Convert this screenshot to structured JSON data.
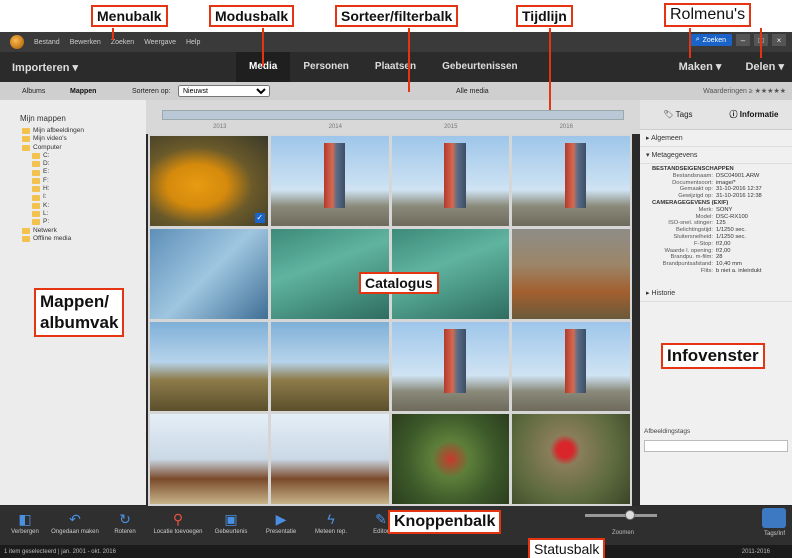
{
  "menubar": {
    "items": [
      "Bestand",
      "Bewerken",
      "Zoeken",
      "Weergave",
      "Help"
    ],
    "search_label": "Zoeken"
  },
  "modebar": {
    "import_label": "Importeren",
    "tabs": [
      "Media",
      "Personen",
      "Plaatsen",
      "Gebeurtenissen"
    ],
    "create_label": "Maken",
    "share_label": "Delen"
  },
  "filterbar": {
    "albums_label": "Albums",
    "folders_label": "Mappen",
    "sort_label": "Sorteren op:",
    "sort_value": "Nieuwst",
    "all_media_label": "Alle media",
    "ratings_label": "Waarderingen"
  },
  "left_panel": {
    "header": "Mijn mappen",
    "folders": [
      {
        "label": "Mijn afbeeldingen",
        "sub": false
      },
      {
        "label": "Mijn video's",
        "sub": false
      },
      {
        "label": "Computer",
        "sub": false
      },
      {
        "label": "C:",
        "sub": true
      },
      {
        "label": "D:",
        "sub": true
      },
      {
        "label": "E:",
        "sub": true
      },
      {
        "label": "F:",
        "sub": true
      },
      {
        "label": "H:",
        "sub": true
      },
      {
        "label": "I:",
        "sub": true
      },
      {
        "label": "K:",
        "sub": true
      },
      {
        "label": "L:",
        "sub": true
      },
      {
        "label": "P:",
        "sub": true
      },
      {
        "label": "Netwerk",
        "sub": false
      },
      {
        "label": "Offline media",
        "sub": false
      }
    ]
  },
  "timeline": {
    "years": [
      "2013",
      "2014",
      "2015",
      "2016"
    ]
  },
  "right_panel": {
    "tab_tags": "Tags",
    "tab_info": "Informatie",
    "section_general": "Algemeen",
    "section_metadata": "Metagegevens",
    "file_props_header": "BESTANDSEIGENSCHAPPEN",
    "file_props": [
      {
        "k": "Bestandsnaam:",
        "v": "DSC04901.ARW"
      },
      {
        "k": "Documentsoort:",
        "v": "image/*"
      },
      {
        "k": "Gemaakt op:",
        "v": "31-10-2016 12:37"
      },
      {
        "k": "Gewijzigd op:",
        "v": "31-10-2016 12:38"
      }
    ],
    "camera_header": "CAMERAGEGEVENS (EXIF)",
    "camera_props": [
      {
        "k": "Merk:",
        "v": "SONY"
      },
      {
        "k": "Model:",
        "v": "DSC-RX100"
      },
      {
        "k": "ISO-snel. stinger:",
        "v": "125"
      },
      {
        "k": "Belichtingstijd:",
        "v": "1/1250 sec."
      },
      {
        "k": "Sluitersnelheid:",
        "v": "1/1250 sec."
      },
      {
        "k": "F-Stop:",
        "v": "f/2,00"
      },
      {
        "k": "Waarde l. opening:",
        "v": "f/2,00"
      },
      {
        "k": "Brandpu. m-film:",
        "v": "28"
      },
      {
        "k": "Brandpuntsafstand:",
        "v": "10,40 mm"
      },
      {
        "k": "Flits:",
        "v": "b niet a. inleirdukt"
      }
    ],
    "section_history": "Historie",
    "image_tags_label": "Afbeeldingstags"
  },
  "buttonbar": {
    "buttons": [
      "Verbergen",
      "Ongedaan maken",
      "Roteren",
      "Locatie toevoegen",
      "Gebeurtenis",
      "Presentatie",
      "Meteen rep.",
      "Editor"
    ],
    "zoom_label": "Zoomen",
    "tags_label": "Tags/Inf"
  },
  "statusbar": {
    "left_text": "1 item geselecteerd | jan. 2001 - okt. 2016",
    "right_text": "2011-2016"
  },
  "callouts": {
    "menubar": "Menubalk",
    "modebar": "Modusbalk",
    "filterbar": "Sorteer/filterbalk",
    "timeline": "Tijdlijn",
    "rolemenus": "Rolmenu's",
    "catalog": "Catalogus",
    "folders_pane": "Mappen/\nalbumvak",
    "info_pane": "Infovenster",
    "buttonbar": "Knoppenbalk",
    "statusbar": "Statusbalk"
  },
  "colors": {
    "callout_border": "#e53411",
    "accent": "#1a64c9"
  }
}
